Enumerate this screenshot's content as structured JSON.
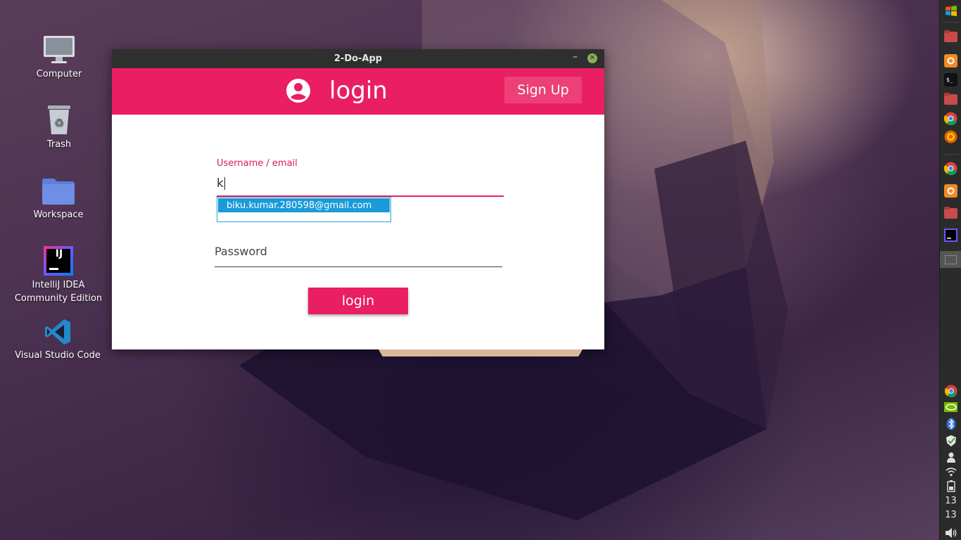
{
  "desktop": {
    "icons": [
      {
        "label": "Computer"
      },
      {
        "label": "Trash"
      },
      {
        "label": "Workspace"
      },
      {
        "label": "IntelliJ IDEA Community Edition",
        "badge": "IJ"
      },
      {
        "label": "Visual Studio Code"
      }
    ]
  },
  "window": {
    "title": "2-Do-App",
    "minimize_glyph": "–",
    "close_glyph": "✕",
    "header": {
      "title": "login",
      "signup_label": "Sign Up"
    },
    "form": {
      "username_label": "Username / email",
      "username_value": "k",
      "autocomplete_suggestion": "biku.kumar.280598@gmail.com",
      "password_placeholder": "Password",
      "login_label": "login"
    }
  },
  "dock": {
    "clock_hour": "13",
    "clock_minute": "13",
    "items": [
      "start-menu-icon",
      "files-icon",
      "firefox-icon",
      "terminal-icon",
      "folder-icon",
      "chrome-icon",
      "firefox-dev-icon",
      "chrome-icon",
      "firefox-icon",
      "files-icon",
      "intellij-icon",
      "window-icon"
    ],
    "tray": [
      "chrome-icon",
      "nvidia-icon",
      "bluetooth-icon",
      "security-shield-icon",
      "user-icon",
      "wifi-icon",
      "battery-icon",
      "volume-icon"
    ]
  },
  "colors": {
    "accent": "#e91e63",
    "autocomplete_highlight": "#1a9bd7",
    "titlebar": "#2f2f2f"
  }
}
